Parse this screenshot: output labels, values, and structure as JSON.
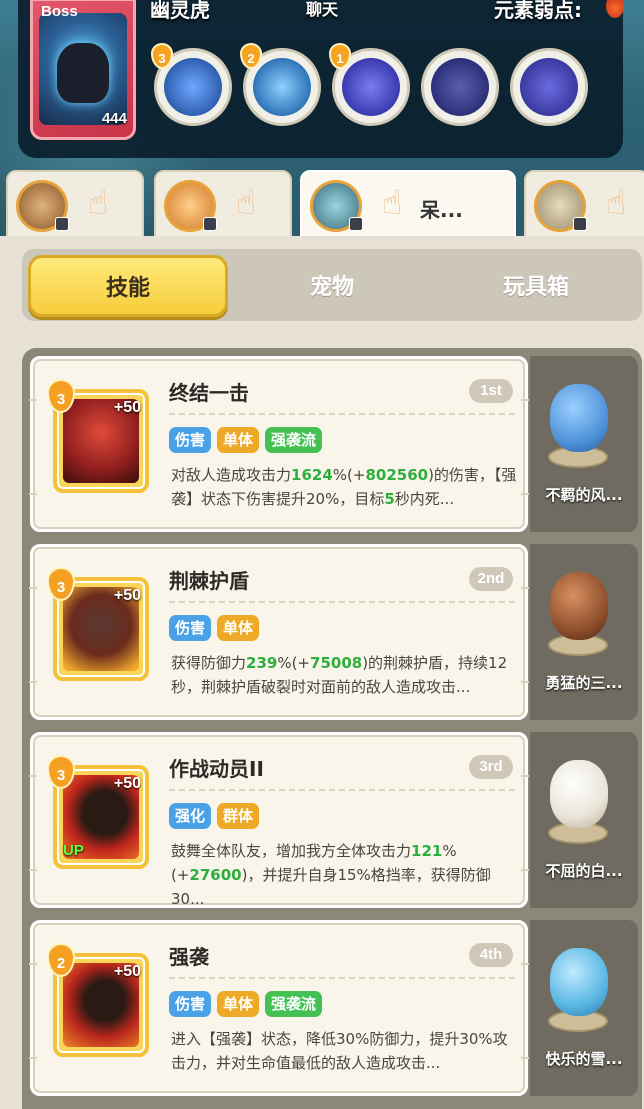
{
  "boss": {
    "tag": "Boss",
    "hp": "444",
    "name": "幽灵虎",
    "chat": "聊天",
    "weakness_label": "元素弱点:",
    "skills": [
      {
        "level": "3",
        "icon": "claw-slash-icon",
        "color": "#2f5fb0"
      },
      {
        "level": "2",
        "icon": "lightning-claw-icon",
        "color": "#2e74b8"
      },
      {
        "level": "1",
        "icon": "ghost-shadow-icon",
        "color": "#3a3bb0"
      },
      {
        "level": "",
        "icon": "star-strike-icon",
        "color": "#2c2f78"
      },
      {
        "level": "",
        "icon": "ghost-tiger-icon",
        "color": "#3b3aa0"
      }
    ]
  },
  "heroes": [
    {
      "label": "",
      "color": "#8a5a2b"
    },
    {
      "label": "",
      "color": "#d27b2a"
    },
    {
      "label": "呆...",
      "color": "#3b6a7a"
    },
    {
      "label": "",
      "color": "#9b8c6a"
    }
  ],
  "tabs": {
    "skills": "技能",
    "pets": "宠物",
    "toybox": "玩具箱"
  },
  "skills": [
    {
      "level": "3",
      "plus": "+50",
      "up": "",
      "title": "终结一击",
      "rank": "1st",
      "tags": [
        "伤害",
        "单体",
        "强袭流"
      ],
      "desc_a": "对敌人造成攻击力",
      "desc_b": "1624",
      "desc_c": "%(+",
      "desc_d": "802560",
      "desc_e": ")的伤害，【强袭】状态下伤害提升20%，目标",
      "desc_f": "5",
      "desc_g": "秒内死...",
      "pet_name": "不羁的风...",
      "icon_color": "#8e1e1e",
      "pet_color": "#4a8ed6"
    },
    {
      "level": "3",
      "plus": "+50",
      "up": "",
      "title": "荆棘护盾",
      "rank": "2nd",
      "tags": [
        "伤害",
        "单体"
      ],
      "desc_a": "获得防御力",
      "desc_b": "239",
      "desc_c": "%(+",
      "desc_d": "75008",
      "desc_e": ")的荆棘护盾，持续12秒，荆棘护盾破裂时对面前的敌人造成攻击...",
      "desc_f": "",
      "desc_g": "",
      "pet_name": "勇猛的三...",
      "icon_color": "#6b2b1e",
      "pet_color": "#8a4b2a"
    },
    {
      "level": "3",
      "plus": "+50",
      "up": "UP",
      "title": "作战动员II",
      "rank": "3rd",
      "tags": [
        "强化",
        "群体"
      ],
      "desc_a": "鼓舞全体队友，增加我方全体攻击力",
      "desc_b": "121",
      "desc_c": "%(+",
      "desc_d": "27600",
      "desc_e": ")，并提升自身15%格挡率，获得防御30...",
      "desc_f": "",
      "desc_g": "",
      "pet_name": "不屈的白...",
      "icon_color": "#c0261c",
      "pet_color": "#e9e4d8"
    },
    {
      "level": "2",
      "plus": "+50",
      "up": "",
      "title": "强袭",
      "rank": "4th",
      "tags": [
        "伤害",
        "单体",
        "强袭流"
      ],
      "desc_a": "进入【强袭】状态，降低30%防御力，提升30%攻击力，并对生命值最低的敌人造成攻击...",
      "desc_b": "",
      "desc_c": "",
      "desc_d": "",
      "desc_e": "",
      "desc_f": "",
      "desc_g": "",
      "pet_name": "快乐的雪...",
      "icon_color": "#b8261c",
      "pet_color": "#5ab7e4"
    }
  ]
}
